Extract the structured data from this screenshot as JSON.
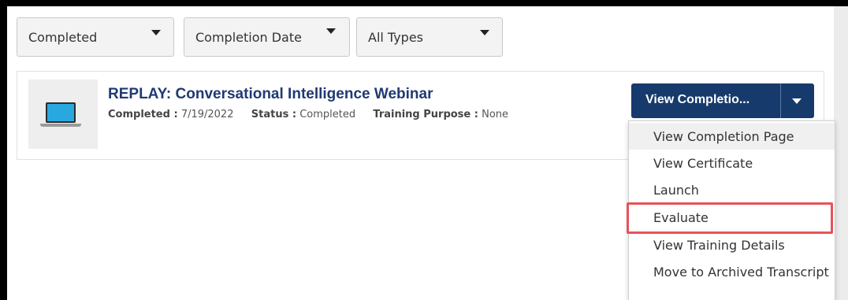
{
  "filters": {
    "status": "Completed",
    "sort": "Completion Date",
    "type": "All Types"
  },
  "training": {
    "title": "REPLAY: Conversational Intelligence Webinar",
    "completed_label": "Completed :",
    "completed_value": "7/19/2022",
    "status_label": "Status :",
    "status_value": "Completed",
    "purpose_label": "Training Purpose :",
    "purpose_value": "None",
    "action_label": "View Completio..."
  },
  "menu": {
    "items": [
      "View Completion Page",
      "View Certificate",
      "Launch",
      "Evaluate",
      "View Training Details",
      "Move to Archived Transcript"
    ]
  },
  "colors": {
    "primary_button": "#163a6b",
    "title": "#1f3a73",
    "highlight": "#e8525a"
  },
  "icons": [
    "chevron-down-icon",
    "laptop-icon"
  ]
}
